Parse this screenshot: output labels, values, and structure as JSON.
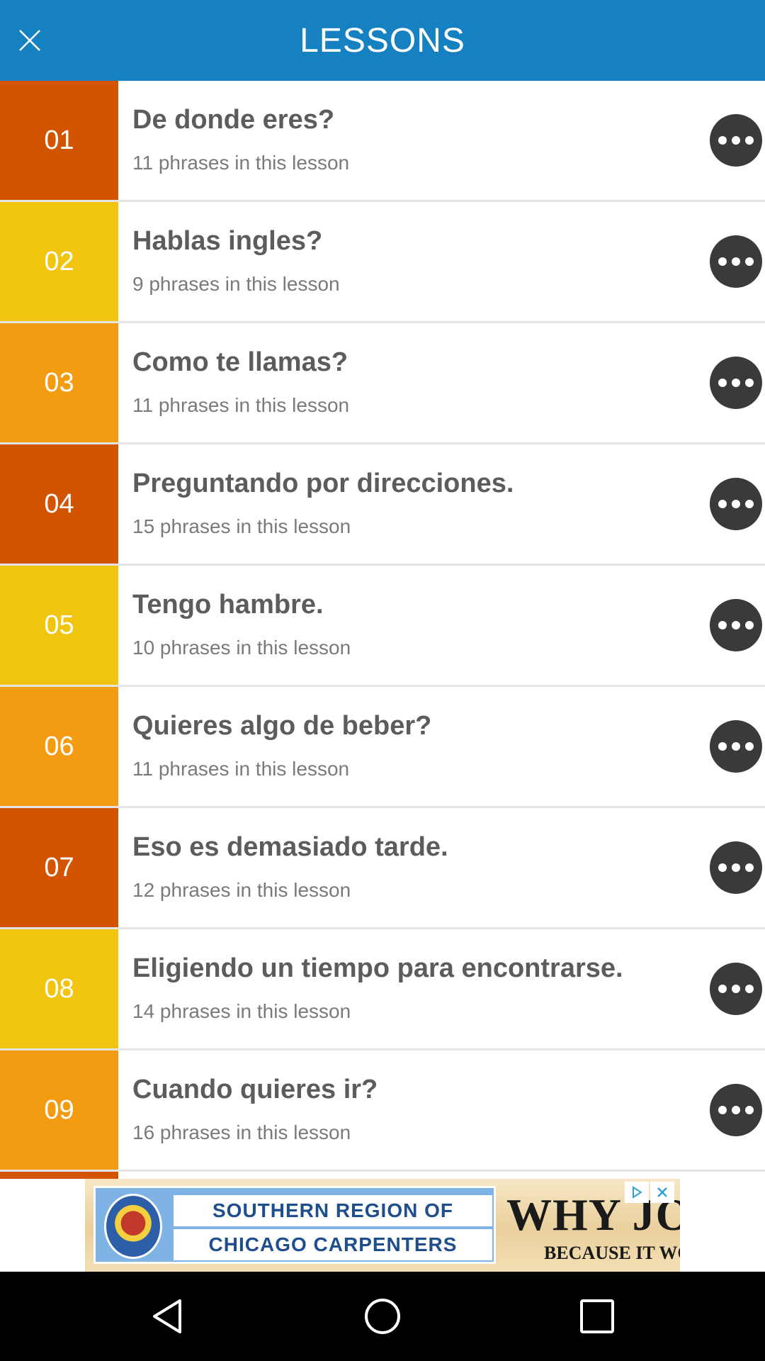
{
  "header": {
    "title": "LESSONS"
  },
  "lessons": [
    {
      "number": "01",
      "title": "De donde eres?",
      "subtitle": "11 phrases in this lesson"
    },
    {
      "number": "02",
      "title": "Hablas ingles?",
      "subtitle": "9 phrases in this lesson"
    },
    {
      "number": "03",
      "title": "Como te llamas?",
      "subtitle": "11 phrases in this lesson"
    },
    {
      "number": "04",
      "title": "Preguntando por direcciones.",
      "subtitle": "15 phrases in this lesson"
    },
    {
      "number": "05",
      "title": "Tengo hambre.",
      "subtitle": "10 phrases in this lesson"
    },
    {
      "number": "06",
      "title": "Quieres algo de beber?",
      "subtitle": "11 phrases in this lesson"
    },
    {
      "number": "07",
      "title": "Eso es demasiado tarde.",
      "subtitle": "12 phrases in this lesson"
    },
    {
      "number": "08",
      "title": "Eligiendo un tiempo para encontrarse.",
      "subtitle": "14 phrases in this lesson"
    },
    {
      "number": "09",
      "title": "Cuando quieres ir?",
      "subtitle": "16 phrases in this lesson"
    }
  ],
  "ad": {
    "line1": "SOUTHERN REGION OF",
    "line2": "CHICAGO CARPENTERS",
    "headline": "WHY JOIN?",
    "tagline": "BECAUSE IT WORKS!"
  },
  "icons": {
    "close": "close-icon",
    "more": "more-options-icon",
    "back": "back-icon",
    "home": "home-icon",
    "recents": "recents-icon"
  },
  "colors": {
    "header": "#1581c0",
    "badge_dark": "#d35400",
    "badge_yellow": "#f1c40f",
    "badge_orange": "#f39c12"
  }
}
